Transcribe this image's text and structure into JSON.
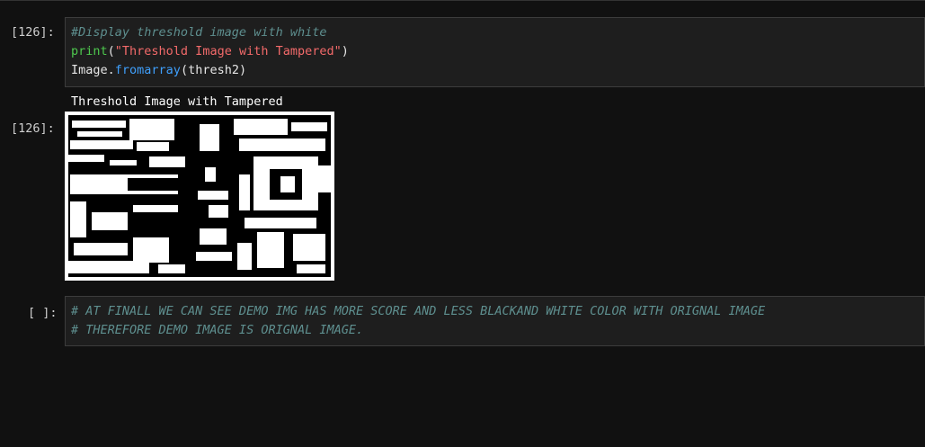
{
  "cells": [
    {
      "prompt": "[126]:",
      "code": {
        "comment": "#Display threshold image with white",
        "print_fn": "print",
        "print_open": "(",
        "print_str": "\"Threshold Image with Tampered\"",
        "print_close": ")",
        "image_obj": "Image",
        "image_dot": ".",
        "image_method": "fromarray",
        "image_args": "(thresh2)"
      },
      "stdout": "Threshold Image with Tampered",
      "output_prompt": "[126]:",
      "output_image": "threshold-binary-image"
    },
    {
      "prompt": "[ ]:",
      "lines": [
        "# AT FINALL WE CAN SEE DEMO IMG HAS MORE SCORE AND LESS BLACKAND WHITE COLOR WITH ORIGNAL IMAGE",
        "# THEREFORE DEMO IMAGE IS ORIGNAL IMAGE."
      ]
    }
  ],
  "colors": {
    "background": "#111111",
    "cell_bg": "#1e1e1e",
    "comment": "#5e8f8f",
    "function": "#4ec94e",
    "string": "#f36a6a",
    "attribute": "#3f9ffb"
  }
}
